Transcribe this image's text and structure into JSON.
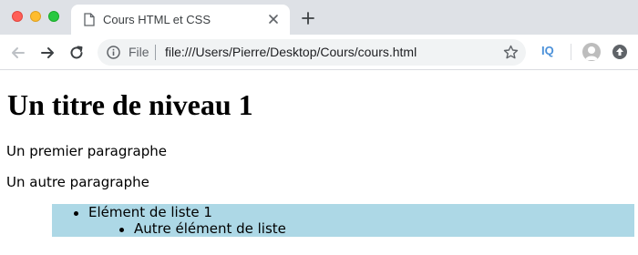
{
  "window": {
    "controls": [
      "close",
      "minimize",
      "zoom"
    ]
  },
  "tab": {
    "title": "Cours HTML et CSS",
    "favicon": "document-icon"
  },
  "toolbar": {
    "scheme_label": "File",
    "url": "file:///Users/Pierre/Desktop/Cours/cours.html",
    "extension_label": "IQ"
  },
  "page": {
    "heading": "Un titre de niveau 1",
    "paragraphs": [
      "Un premier paragraphe",
      "Un autre paragraphe"
    ],
    "list": {
      "background_color": "#add8e6",
      "items": [
        "Elément de liste 1",
        "Autre élément de liste"
      ]
    }
  }
}
